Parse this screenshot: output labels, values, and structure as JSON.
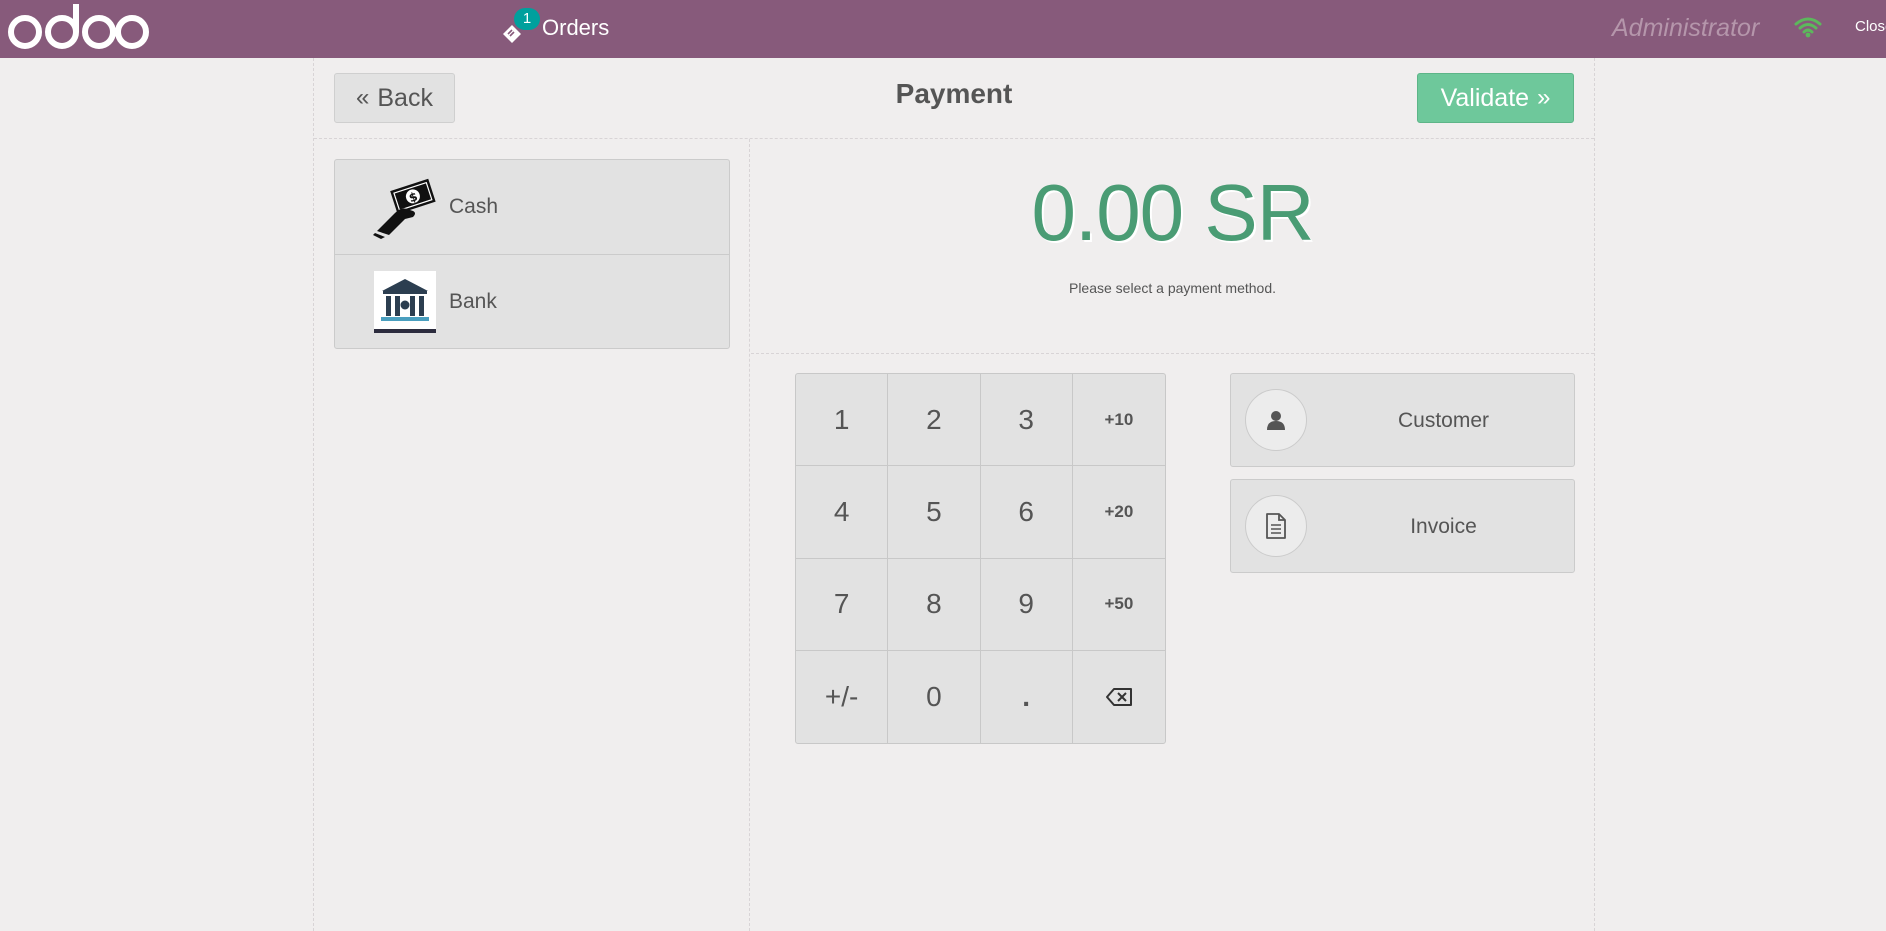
{
  "topbar": {
    "logo_text": "odoo",
    "orders_badge": "1",
    "orders_label": "Orders",
    "user": "Administrator",
    "close_label": "Close"
  },
  "header": {
    "back_label": "Back",
    "title": "Payment",
    "validate_label": "Validate"
  },
  "payment_methods": [
    {
      "label": "Cash",
      "icon": "cash-hand-icon"
    },
    {
      "label": "Bank",
      "icon": "bank-building-icon"
    }
  ],
  "summary": {
    "total": "0.00 SR",
    "message": "Please select a payment method."
  },
  "numpad": {
    "keys": [
      "1",
      "2",
      "3",
      "+10",
      "4",
      "5",
      "6",
      "+20",
      "7",
      "8",
      "9",
      "+50",
      "+/-",
      "0",
      ".",
      "backspace"
    ]
  },
  "actions": {
    "customer_label": "Customer",
    "invoice_label": "Invoice"
  },
  "colors": {
    "topbar": "#875a7b",
    "validate": "#6ec89b",
    "total": "#4a9c74",
    "badge": "#00a09d",
    "wifi": "#5cb85c"
  }
}
